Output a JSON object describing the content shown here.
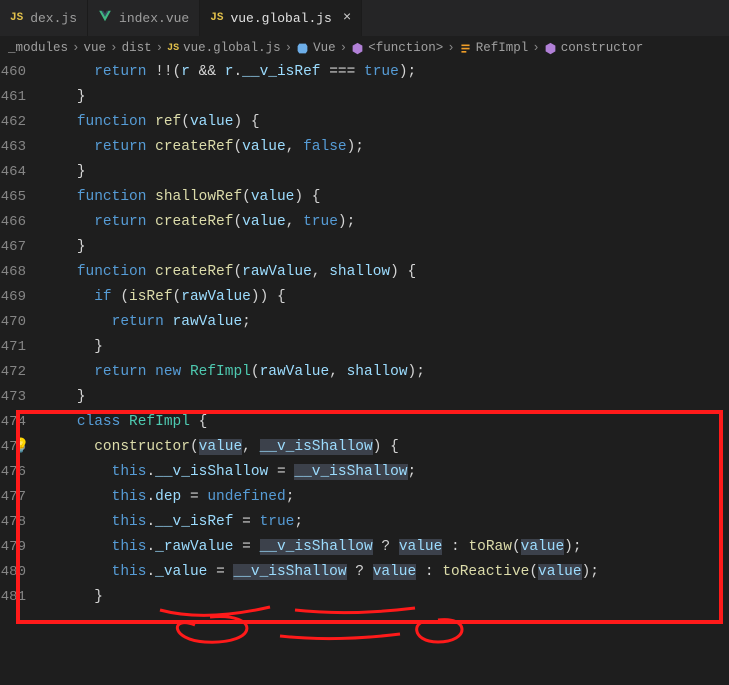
{
  "tabs": [
    {
      "name": "dex.js",
      "icon": "JS",
      "active": false
    },
    {
      "name": "index.vue",
      "icon": "V",
      "active": false
    },
    {
      "name": "vue.global.js",
      "icon": "JS",
      "active": true
    }
  ],
  "breadcrumb": {
    "parts": [
      "_modules",
      "vue",
      "dist",
      "vue.global.js",
      "Vue",
      "<function>",
      "RefImpl",
      "constructor"
    ]
  },
  "lines": {
    "start": 460,
    "end": 481
  },
  "code": {
    "l460": {
      "return": "return",
      "op": "!!(",
      "r": "r",
      "and": " && ",
      "rr": "r",
      "dot": ".",
      "prop": "__v_isRef",
      "eq": " === ",
      "true": "true",
      "end": ");"
    },
    "l461": "}",
    "l462": {
      "fn": "function",
      "name": "ref",
      "args": "value"
    },
    "l463": {
      "return": "return",
      "call": "createRef",
      "a1": "value",
      "a2": "false"
    },
    "l464": "}",
    "l465": {
      "fn": "function",
      "name": "shallowRef",
      "args": "value"
    },
    "l466": {
      "return": "return",
      "call": "createRef",
      "a1": "value",
      "a2": "true"
    },
    "l467": "}",
    "l468": {
      "fn": "function",
      "name": "createRef",
      "a1": "rawValue",
      "a2": "shallow"
    },
    "l469": {
      "if": "if",
      "call": "isRef",
      "arg": "rawValue"
    },
    "l470": {
      "return": "return",
      "v": "rawValue"
    },
    "l471": "}",
    "l472": {
      "return": "return",
      "new": "new",
      "cls": "RefImpl",
      "a1": "rawValue",
      "a2": "shallow"
    },
    "l473": "}",
    "l474": {
      "kw": "class",
      "cls": "RefImpl"
    },
    "l475": {
      "name": "constructor",
      "a1": "value",
      "a2": "__v_isShallow"
    },
    "l476": {
      "this": "this",
      "prop": "__v_isShallow",
      "rhs": "__v_isShallow"
    },
    "l477": {
      "this": "this",
      "prop": "dep",
      "rhs": "undefined"
    },
    "l478": {
      "this": "this",
      "prop": "__v_isRef",
      "rhs": "true"
    },
    "l479": {
      "this": "this",
      "prop": "_rawValue",
      "cond": "__v_isShallow",
      "t": "value",
      "fcall": "toRaw",
      "farg": "value"
    },
    "l480": {
      "this": "this",
      "prop": "_value",
      "cond": "__v_isShallow",
      "t": "value",
      "fcall": "toReactive",
      "farg": "value"
    },
    "l481": "}"
  }
}
